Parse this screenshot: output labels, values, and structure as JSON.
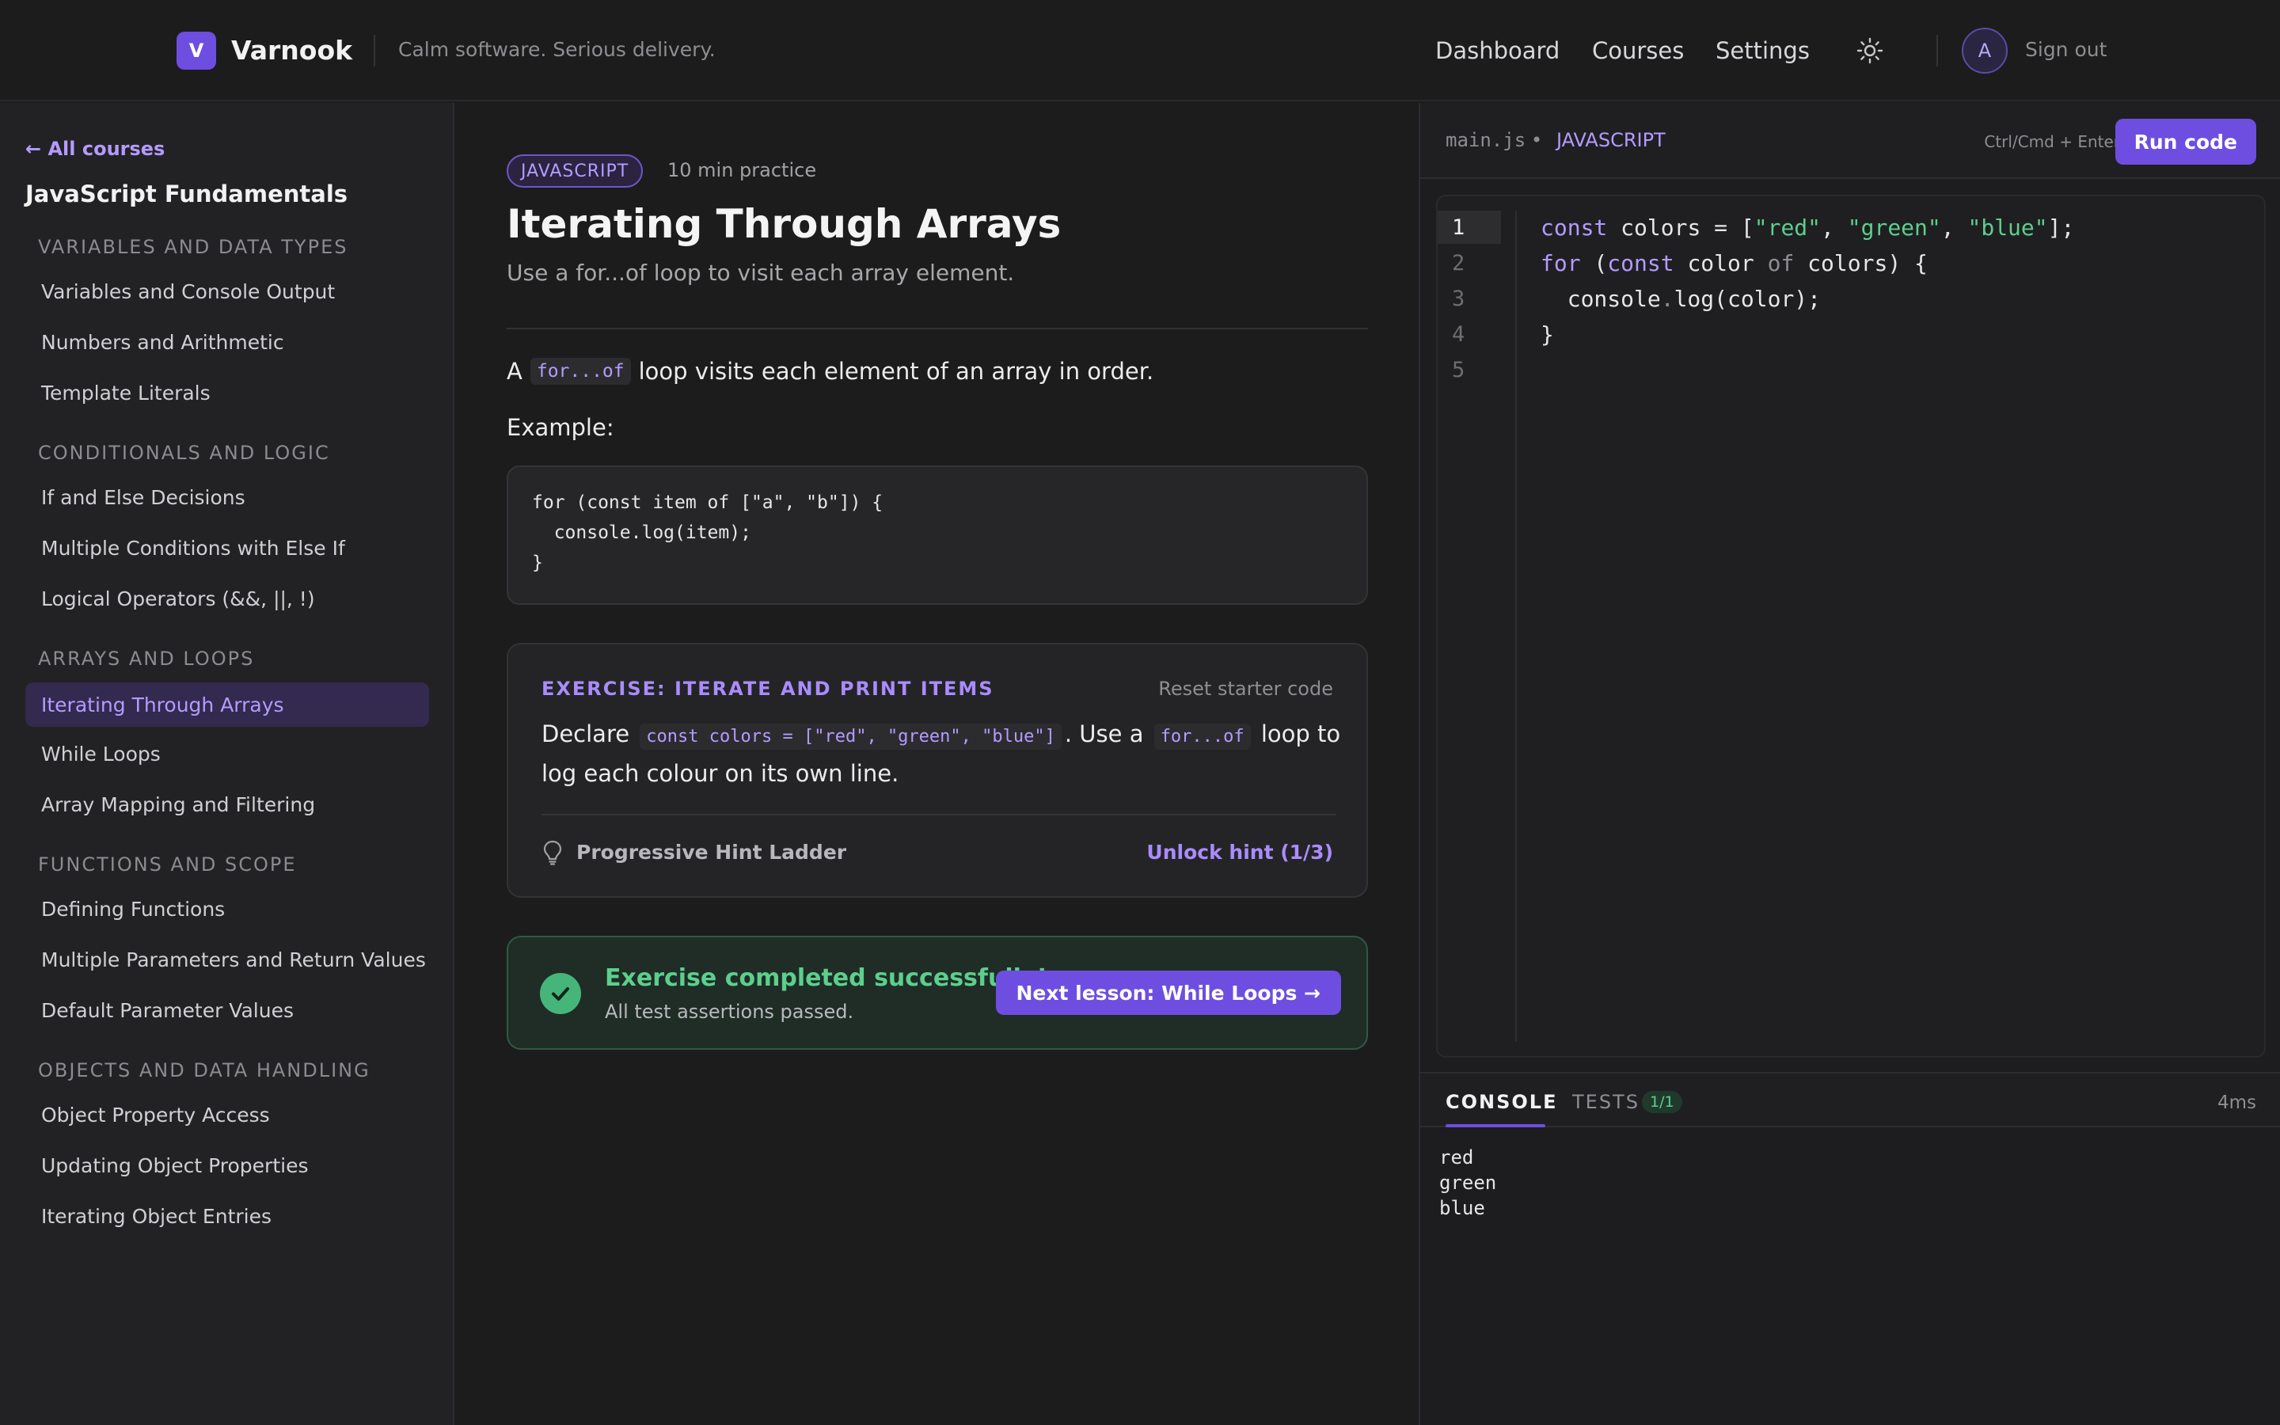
{
  "header": {
    "logo_letter": "V",
    "brand": "Varnook",
    "tagline": "Calm software. Serious delivery.",
    "nav": [
      "Dashboard",
      "Courses",
      "Settings"
    ],
    "theme_icon": "sun-icon",
    "avatar_initial": "A",
    "sign_out": "Sign out"
  },
  "sidebar": {
    "back": "← All courses",
    "course_title": "JavaScript Fundamentals",
    "sections": [
      {
        "title": "VARIABLES AND DATA TYPES",
        "items": [
          "Variables and Console Output",
          "Numbers and Arithmetic",
          "Template Literals"
        ]
      },
      {
        "title": "CONDITIONALS AND LOGIC",
        "items": [
          "If and Else Decisions",
          "Multiple Conditions with Else If",
          "Logical Operators (&&, ||, !)"
        ]
      },
      {
        "title": "ARRAYS AND LOOPS",
        "items": [
          "Iterating Through Arrays",
          "While Loops",
          "Array Mapping and Filtering"
        ]
      },
      {
        "title": "FUNCTIONS AND SCOPE",
        "items": [
          "Defining Functions",
          "Multiple Parameters and Return Values",
          "Default Parameter Values"
        ]
      },
      {
        "title": "OBJECTS AND DATA HANDLING",
        "items": [
          "Object Property Access",
          "Updating Object Properties",
          "Iterating Object Entries"
        ]
      }
    ],
    "active_item": "Iterating Through Arrays"
  },
  "lesson": {
    "language_badge": "JAVASCRIPT",
    "duration": "10 min practice",
    "title": "Iterating Through Arrays",
    "subtitle": "Use a for...of loop to visit each array element.",
    "para_prefix": "A",
    "para_code": "for...of",
    "para_suffix": "loop visits each element of an array in order.",
    "example_label": "Example:",
    "example_code": [
      "for (const item of [\"a\", \"b\"]) {",
      "  console.log(item);",
      "}"
    ]
  },
  "exercise": {
    "title": "EXERCISE: ITERATE AND PRINT ITEMS",
    "reset": "Reset starter code",
    "text_1": "Declare",
    "code_1": "const colors = [\"red\", \"green\", \"blue\"]",
    "text_2": ". Use a",
    "code_2": "for...of",
    "text_3": "loop to log each colour on its own line.",
    "hint_icon": "lightbulb-icon",
    "hint_label": "Progressive Hint Ladder",
    "unlock": "Unlock hint (1/3)"
  },
  "success": {
    "icon": "check-circle-icon",
    "title": "Exercise completed successfully!",
    "subtitle": "All test assertions passed.",
    "next_button": "Next lesson: While Loops →"
  },
  "editor": {
    "filename": "main.js",
    "separator": "•",
    "language": "JAVASCRIPT",
    "shortcut": "Ctrl/Cmd + Enter",
    "run_button": "Run code",
    "line_numbers": [
      "1",
      "2",
      "3",
      "4",
      "5"
    ],
    "current_line": "1",
    "code_tokens": [
      {
        "kw1": "const",
        "t1": " colors = [",
        "s1": "\"red\"",
        "t2": ", ",
        "s2": "\"green\"",
        "t3": ", ",
        "s3": "\"blue\"",
        "t4": "];"
      },
      {
        "kw1": "for",
        "t1": " (",
        "kw2": "const",
        "t2": " color ",
        "d1": "of",
        "t3": " colors) {"
      },
      {
        "t1": "  console",
        "d1": ".",
        "t2": "log(color);"
      },
      {
        "t1": "}"
      },
      {
        "t1": ""
      }
    ]
  },
  "console": {
    "tab_console": "CONSOLE",
    "tab_tests": "TESTS",
    "tests_badge": "1/1",
    "timing": "4ms",
    "output": [
      "red",
      "green",
      "blue"
    ]
  },
  "colors": {
    "accent": "#6d4ee0",
    "accent_text": "#b49bff",
    "success": "#5ccf8d",
    "background": "#1c1c1d"
  }
}
